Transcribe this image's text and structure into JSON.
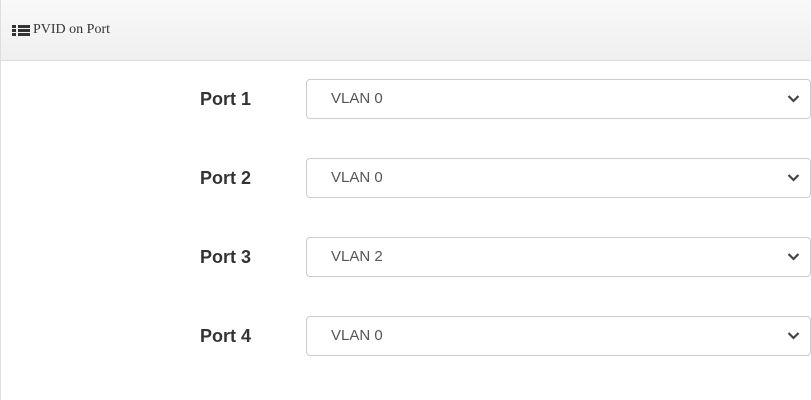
{
  "panel": {
    "title": "PVID on Port",
    "header_icon": "list-icon"
  },
  "ports": [
    {
      "label": "Port 1",
      "value": "VLAN 0"
    },
    {
      "label": "Port 2",
      "value": "VLAN 0"
    },
    {
      "label": "Port 3",
      "value": "VLAN 2"
    },
    {
      "label": "Port 4",
      "value": "VLAN 0"
    }
  ],
  "colors": {
    "header_background": "#f2f2f2",
    "border": "#cccccc",
    "label_text": "#333333",
    "select_text": "#555555"
  }
}
